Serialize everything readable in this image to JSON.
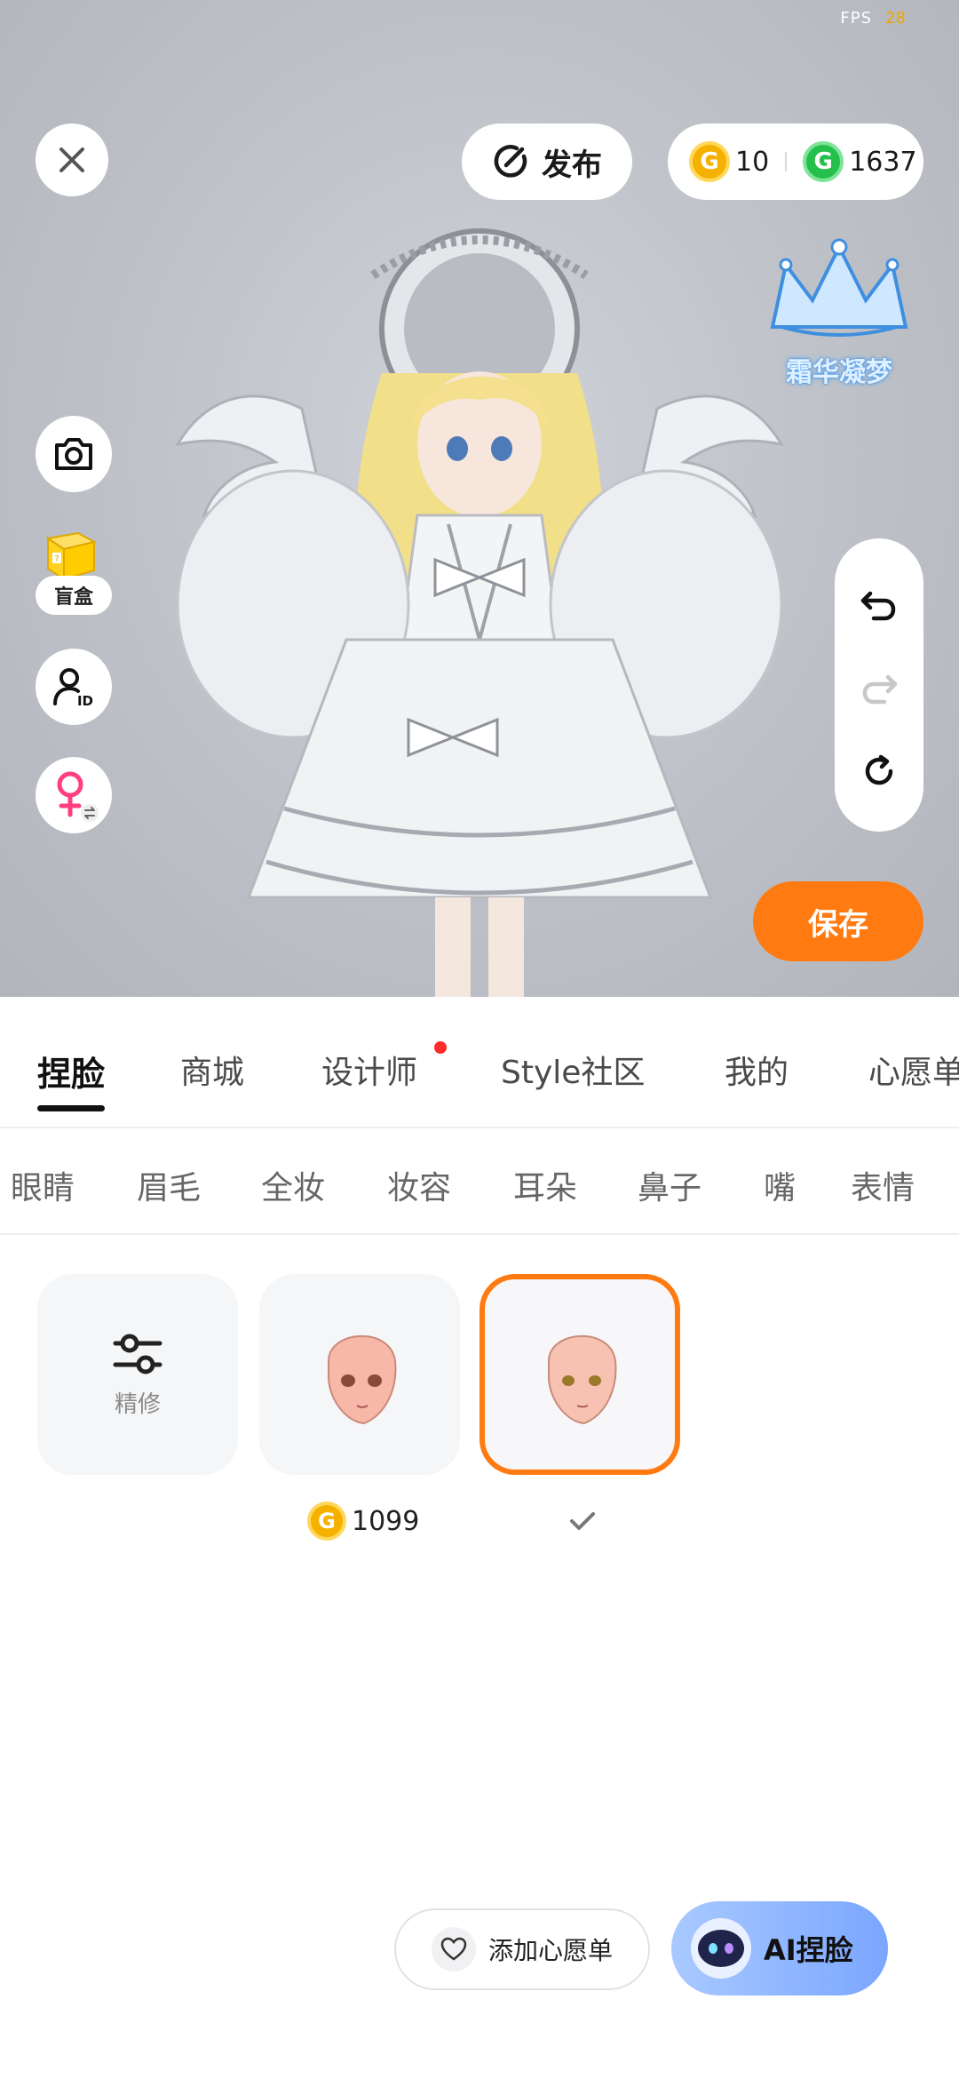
{
  "hud": {
    "fps_label": "FPS",
    "fps_value": "28"
  },
  "top_bar": {
    "publish_label": "发布",
    "gold_coin_symbol": "G",
    "gold_balance": "10",
    "green_coin_symbol": "G",
    "green_balance": "1637"
  },
  "brand_logo_text": "霜华凝梦",
  "side_tools": {
    "blindbox_label": "盲盒"
  },
  "edit_controls": {
    "save_label": "保存"
  },
  "main_tabs": {
    "items": [
      {
        "label": "捏脸",
        "active": true
      },
      {
        "label": "商城"
      },
      {
        "label": "设计师",
        "badge": true
      },
      {
        "label": "Style社区"
      },
      {
        "label": "我的"
      },
      {
        "label": "心愿单"
      }
    ]
  },
  "sub_tabs": {
    "items": [
      {
        "label": "眼睛"
      },
      {
        "label": "眉毛"
      },
      {
        "label": "全妆"
      },
      {
        "label": "妆容"
      },
      {
        "label": "耳朵"
      },
      {
        "label": "鼻子"
      },
      {
        "label": "嘴"
      },
      {
        "label": "表情"
      }
    ]
  },
  "items_grid": {
    "refine_label": "精修",
    "face_item_1_price_symbol": "G",
    "face_item_1_price": "1099",
    "face_item_2_selected": true
  },
  "bottom_actions": {
    "wishlist_label": "添加心愿单",
    "ai_face_label": "AI捏脸"
  },
  "colors": {
    "accent": "#ff7a10",
    "gold_coin": "#f5b100",
    "green_coin": "#25c04b",
    "badge_red": "#ff2a2a"
  }
}
